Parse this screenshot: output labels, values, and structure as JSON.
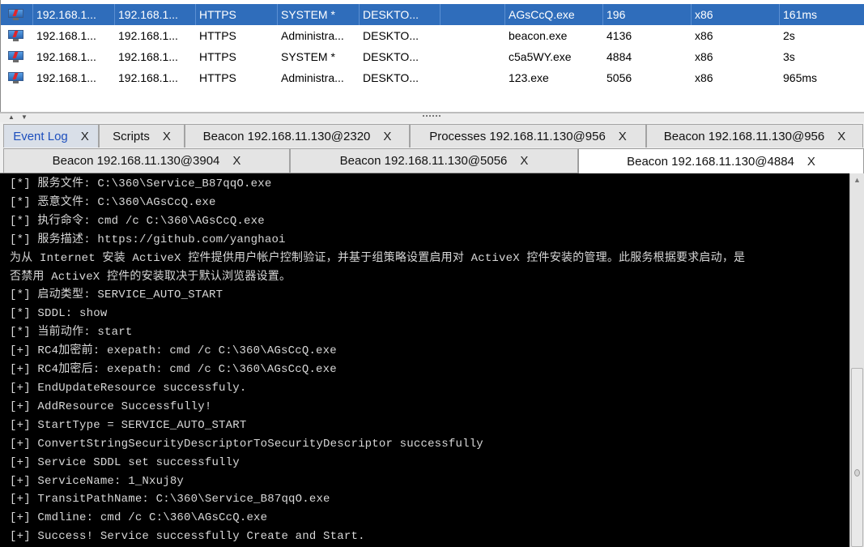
{
  "sessions": [
    {
      "external": "192.168.1...",
      "internal": "192.168.1...",
      "listener": "HTTPS",
      "user": "SYSTEM *",
      "computer": "DESKTO...",
      "note": "",
      "process": "AGsCcQ.exe",
      "pid": "196",
      "arch": "x86",
      "last": "161ms"
    },
    {
      "external": "192.168.1...",
      "internal": "192.168.1...",
      "listener": "HTTPS",
      "user": "Administra...",
      "computer": "DESKTO...",
      "note": "",
      "process": "beacon.exe",
      "pid": "4136",
      "arch": "x86",
      "last": "2s"
    },
    {
      "external": "192.168.1...",
      "internal": "192.168.1...",
      "listener": "HTTPS",
      "user": "SYSTEM *",
      "computer": "DESKTO...",
      "note": "",
      "process": "c5a5WY.exe",
      "pid": "4884",
      "arch": "x86",
      "last": "3s"
    },
    {
      "external": "192.168.1...",
      "internal": "192.168.1...",
      "listener": "HTTPS",
      "user": "Administra...",
      "computer": "DESKTO...",
      "note": "",
      "process": "123.exe",
      "pid": "5056",
      "arch": "x86",
      "last": "965ms"
    }
  ],
  "tabs_row1": [
    {
      "label": "Event Log",
      "close": "X"
    },
    {
      "label": "Scripts",
      "close": "X"
    },
    {
      "label": "Beacon 192.168.11.130@2320",
      "close": "X"
    },
    {
      "label": "Processes 192.168.11.130@956",
      "close": "X"
    },
    {
      "label": "Beacon 192.168.11.130@956",
      "close": "X"
    }
  ],
  "tabs_row2": [
    {
      "label": "Beacon 192.168.11.130@3904",
      "close": "X"
    },
    {
      "label": "Beacon 192.168.11.130@5056",
      "close": "X"
    },
    {
      "label": "Beacon 192.168.11.130@4884",
      "close": "X"
    }
  ],
  "console": {
    "lines": [
      "[*] 服务文件: C:\\360\\Service_B87qqO.exe",
      "[*] 恶意文件: C:\\360\\AGsCcQ.exe",
      "[*] 执行命令: cmd /c C:\\360\\AGsCcQ.exe",
      "[*] 服务描述: https://github.com/yanghaoi",
      "为从 Internet 安装 ActiveX 控件提供用户帐户控制验证，并基于组策略设置启用对 ActiveX 控件安装的管理。此服务根据要求启动，是",
      "否禁用 ActiveX 控件的安装取决于默认浏览器设置。",
      "[*] 启动类型: SERVICE_AUTO_START",
      "[*] SDDL: show",
      "[*] 当前动作: start",
      "[+] RC4加密前: exepath: cmd /c C:\\360\\AGsCcQ.exe",
      "[+] RC4加密后: exepath: cmd /c C:\\360\\AGsCcQ.exe",
      "[+] EndUpdateResource successfuly.",
      "[+] AddResource Successfully!",
      "[+] StartType = SERVICE_AUTO_START",
      "[+] ConvertStringSecurityDescriptorToSecurityDescriptor successfully",
      "[+] Service SDDL set successfully",
      "[+] ServiceName: 1_Nxuj8y",
      "[+] TransitPathName: C:\\360\\Service_B87qqO.exe",
      "[+] Cmdline: cmd /c C:\\360\\AGsCcQ.exe",
      "[+] Success! Service successfully Create and Start."
    ]
  },
  "colors": {
    "selection": "#2f6dbb",
    "console_bg": "#000000",
    "console_fg": "#d8d8d8",
    "event_log_tab_text": "#1d4fbd"
  },
  "icons": {
    "session": "beacon-monitor-icon"
  }
}
